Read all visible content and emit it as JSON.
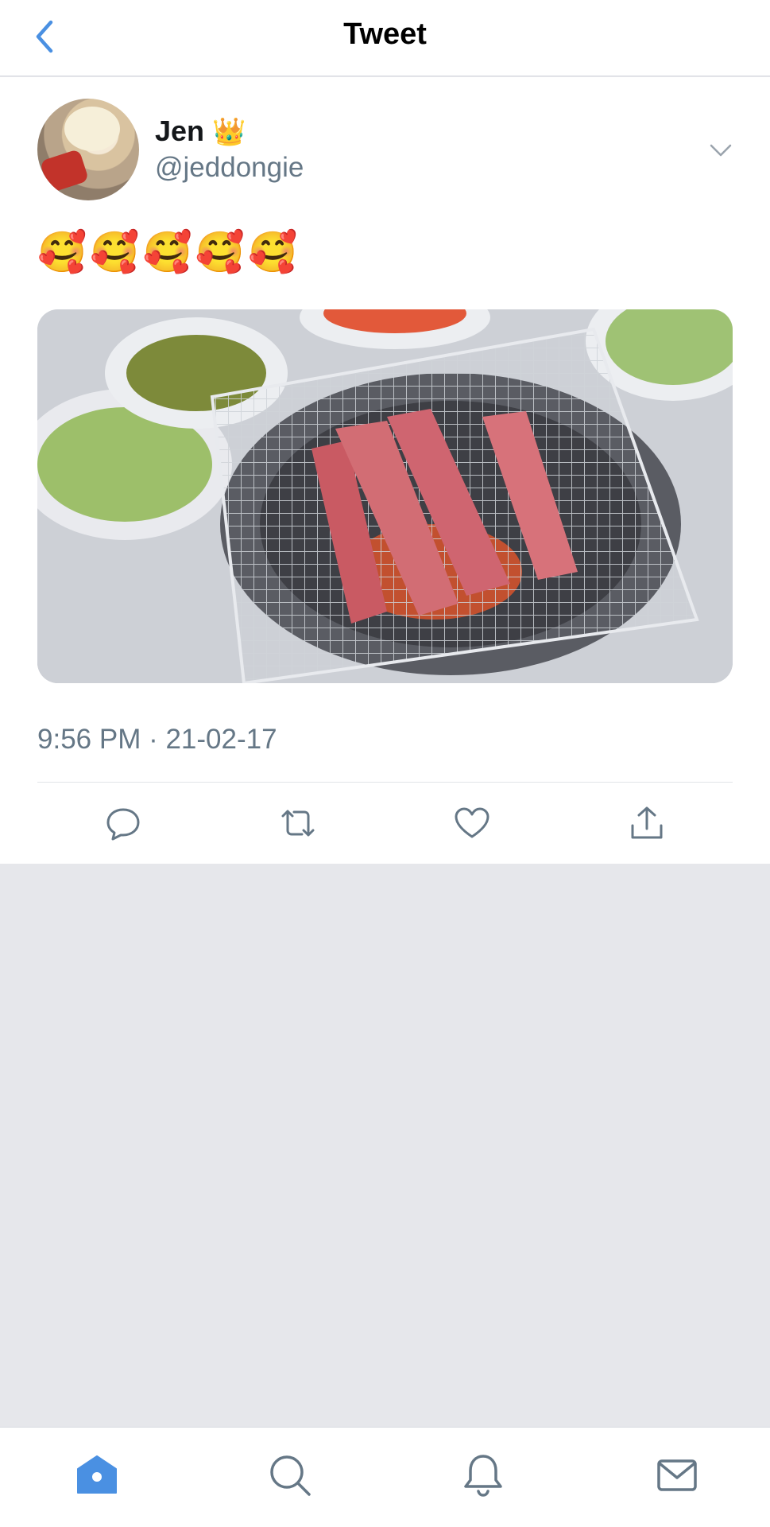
{
  "header": {
    "title": "Tweet"
  },
  "tweet": {
    "author_name": "Jen",
    "author_badge": "👑",
    "handle": "@jeddongie",
    "text": "🥰🥰🥰🥰🥰",
    "timestamp": "9:56 PM · 21-02-17"
  },
  "icons": {
    "back": "chevron-left-icon",
    "caret": "chevron-down-icon",
    "reply": "reply-icon",
    "retweet": "retweet-icon",
    "like": "heart-icon",
    "share": "share-icon",
    "home": "home-icon",
    "search": "search-icon",
    "notifications": "bell-icon",
    "messages": "mail-icon"
  },
  "colors": {
    "accent": "#4a90e2",
    "icon_gray": "#657786",
    "background": "#e6e7eb"
  }
}
